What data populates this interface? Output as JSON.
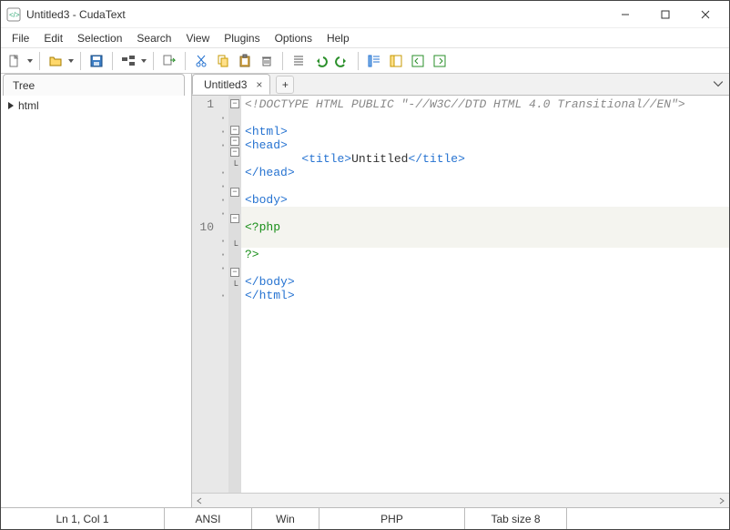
{
  "window": {
    "title": "Untitled3 - CudaText"
  },
  "menu": {
    "file": "File",
    "edit": "Edit",
    "selection": "Selection",
    "search": "Search",
    "view": "View",
    "plugins": "Plugins",
    "options": "Options",
    "help": "Help"
  },
  "toolbar": {
    "icons": [
      "file-new",
      "open",
      "save",
      "folder-tree",
      "sync",
      "cut",
      "copy",
      "paste",
      "delete",
      "unindent",
      "undo",
      "redo",
      "minimap",
      "sidepanel",
      "wrap",
      "goto"
    ]
  },
  "sidebar": {
    "panel_title": "Tree",
    "tree_root": "html"
  },
  "tabs": {
    "items": [
      {
        "label": "Untitled3",
        "active": true
      }
    ],
    "add_label": "+"
  },
  "code": {
    "lines": [
      {
        "n": "1",
        "dot": " ",
        "fold": "-",
        "kind": "doctype",
        "text": "<!DOCTYPE HTML PUBLIC \"-//W3C//DTD HTML 4.0 Transitional//EN\">"
      },
      {
        "n": "",
        "dot": "·",
        "fold": "",
        "kind": "blank",
        "text": ""
      },
      {
        "n": "",
        "dot": "·",
        "fold": "-",
        "kind": "tag",
        "text": "<html>"
      },
      {
        "n": "",
        "dot": "·",
        "fold": "-",
        "kind": "tag",
        "text": "<head>"
      },
      {
        "n": "",
        "dot": "",
        "fold": "-",
        "kind": "title",
        "indent": "        ",
        "open": "<title>",
        "inner": "Untitled",
        "close": "</title>"
      },
      {
        "n": "",
        "dot": "·",
        "fold": "L",
        "kind": "tag",
        "text": "</head>"
      },
      {
        "n": "",
        "dot": "·",
        "fold": "",
        "kind": "blank",
        "text": ""
      },
      {
        "n": "",
        "dot": "·",
        "fold": "-",
        "kind": "tag",
        "text": "<body>"
      },
      {
        "n": "",
        "dot": "·",
        "fold": "",
        "kind": "blank",
        "text": ""
      },
      {
        "n": "10",
        "dot": "",
        "fold": "-",
        "kind": "php",
        "text": "<?php"
      },
      {
        "n": "",
        "dot": "·",
        "fold": "",
        "kind": "blank",
        "text": ""
      },
      {
        "n": "",
        "dot": "·",
        "fold": "L",
        "kind": "php",
        "text": "?>"
      },
      {
        "n": "",
        "dot": "·",
        "fold": "",
        "kind": "blank",
        "text": ""
      },
      {
        "n": "",
        "dot": "",
        "fold": "-",
        "kind": "tag",
        "text": "</body>"
      },
      {
        "n": "",
        "dot": "·",
        "fold": "L",
        "kind": "tag",
        "text": "</html>"
      }
    ]
  },
  "status": {
    "pos": "Ln 1, Col 1",
    "encoding": "ANSI",
    "lineend": "Win",
    "lexer": "PHP",
    "tabsize": "Tab size 8"
  },
  "colors": {
    "tag": "#2673d1",
    "php": "#1a8f1a",
    "doctype": "#888888"
  }
}
